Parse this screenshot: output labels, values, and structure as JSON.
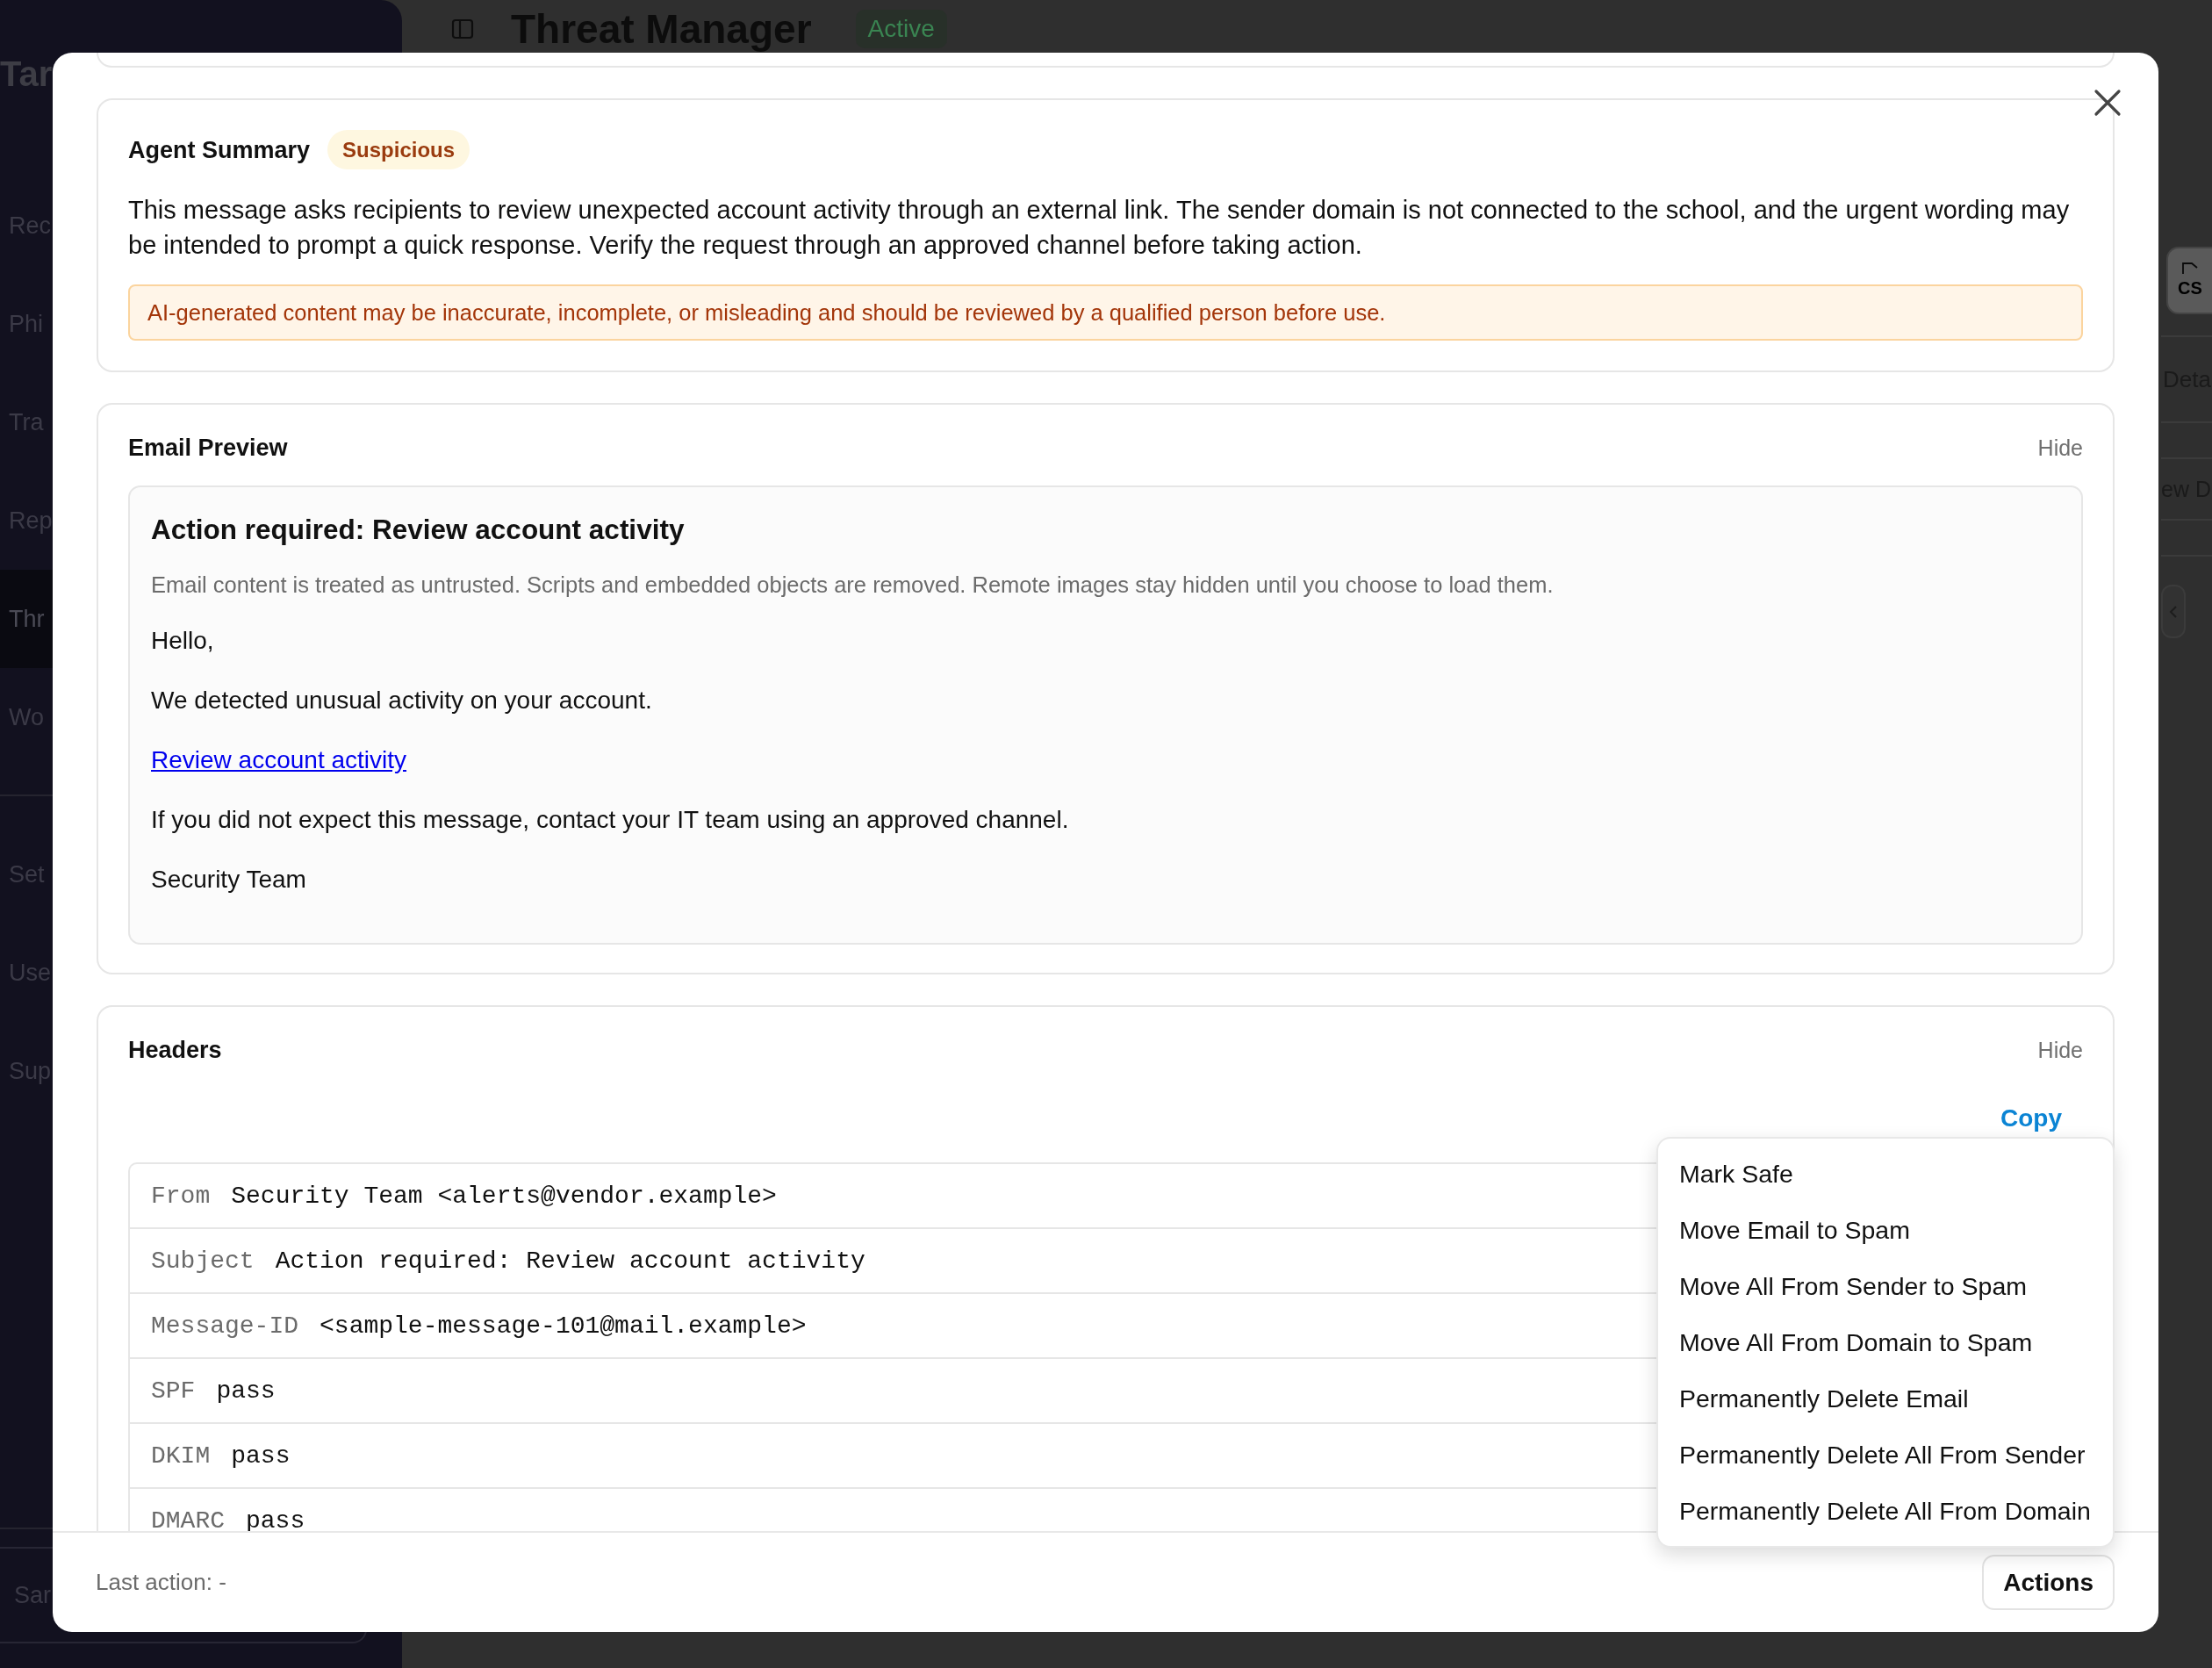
{
  "background": {
    "sidebar": {
      "brand": "Tar",
      "sections": [
        {
          "items": [
            {
              "label": "Rec",
              "selected": false
            },
            {
              "label": "Phi",
              "selected": false
            },
            {
              "label": "Tra",
              "selected": false
            },
            {
              "label": "Rep",
              "selected": false
            },
            {
              "label": "Thr",
              "selected": true
            },
            {
              "label": "Wo",
              "selected": false
            }
          ]
        },
        {
          "items": [
            {
              "label": "Set",
              "selected": false
            },
            {
              "label": "Use",
              "selected": false
            },
            {
              "label": "Sup",
              "selected": false
            }
          ]
        }
      ],
      "account": "Sar"
    },
    "header": {
      "title": "Threat Manager",
      "status": "Active"
    },
    "right_panel": {
      "export_button": "CS",
      "header_cell": "Deta",
      "row_cell": "ew D"
    }
  },
  "dialog": {
    "agent_summary": {
      "title": "Agent Summary",
      "verdict": "Suspicious",
      "summary": "This message asks recipients to review unexpected account activity through an external link. The sender domain is not connected to the school, and the urgent wording may be intended to prompt a quick response. Verify the request through an approved channel before taking action.",
      "disclaimer": "AI-generated content may be inaccurate, incomplete, or misleading and should be reviewed by a qualified person before use."
    },
    "email_preview": {
      "title": "Email Preview",
      "toggle": "Hide",
      "subject": "Action required: Review account activity",
      "safety_note": "Email content is treated as untrusted. Scripts and embedded objects are removed. Remote images stay hidden until you choose to load them.",
      "body": [
        {
          "kind": "text",
          "text": "Hello,"
        },
        {
          "kind": "text",
          "text": "We detected unusual activity on your account."
        },
        {
          "kind": "link",
          "text": "Review account activity"
        },
        {
          "kind": "text",
          "text": "If you did not expect this message, contact your IT team using an approved channel."
        },
        {
          "kind": "text",
          "text": "Security Team"
        }
      ]
    },
    "headers": {
      "title": "Headers",
      "toggle": "Hide",
      "copy": "Copy",
      "rows": [
        {
          "name": "From",
          "value": "Security Team <alerts@vendor.example>"
        },
        {
          "name": "Subject",
          "value": "Action required: Review account activity"
        },
        {
          "name": "Message-ID",
          "value": "<sample-message-101@mail.example>"
        },
        {
          "name": "SPF",
          "value": "pass"
        },
        {
          "name": "DKIM",
          "value": "pass"
        },
        {
          "name": "DMARC",
          "value": "pass"
        }
      ]
    },
    "footer": {
      "last_action": "Last action: -",
      "actions_button": {
        "label": "Actions",
        "expanded": true,
        "menu": [
          "Mark Safe",
          "Move Email to Spam",
          "Move All From Sender to Spam",
          "Move All From Domain to Spam",
          "Permanently Delete Email",
          "Permanently Delete All From Sender",
          "Permanently Delete All From Domain"
        ]
      }
    }
  }
}
